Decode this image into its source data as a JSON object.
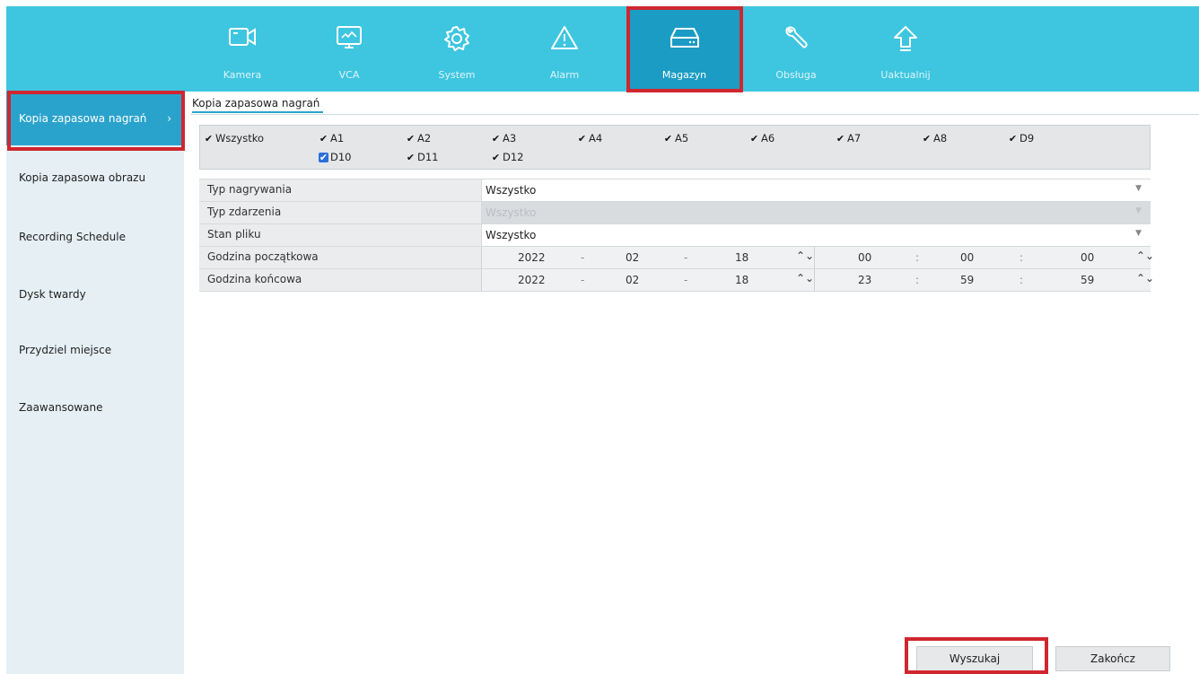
{
  "nav": [
    {
      "id": "kamera",
      "label": "Kamera",
      "icon": "camera-icon"
    },
    {
      "id": "vca",
      "label": "VCA",
      "icon": "monitor-icon"
    },
    {
      "id": "system",
      "label": "System",
      "icon": "gear-icon"
    },
    {
      "id": "alarm",
      "label": "Alarm",
      "icon": "warning-icon"
    },
    {
      "id": "magazyn",
      "label": "Magazyn",
      "icon": "hard-drive-icon",
      "active": true
    },
    {
      "id": "obsluga",
      "label": "Obsługa",
      "icon": "wrench-icon"
    },
    {
      "id": "uaktualnij",
      "label": "Uaktualnij",
      "icon": "upload-arrow-icon"
    }
  ],
  "sidebar": {
    "items": [
      {
        "label": "Kopia zapasowa nagrań",
        "active": true
      },
      {
        "label": "Kopia zapasowa obrazu"
      },
      {
        "label": "Recording Schedule"
      },
      {
        "label": "Dysk twardy"
      },
      {
        "label": "Przydziel miejsce"
      },
      {
        "label": "Zaawansowane"
      }
    ],
    "chevron": "›"
  },
  "tab": {
    "label": "Kopia zapasowa nagrań"
  },
  "channels": {
    "all_label": "Wszystko",
    "items": [
      {
        "label": "A1",
        "checked": true
      },
      {
        "label": "A2",
        "checked": true
      },
      {
        "label": "A3",
        "checked": true
      },
      {
        "label": "A4",
        "checked": true
      },
      {
        "label": "A5",
        "checked": true
      },
      {
        "label": "A6",
        "checked": true
      },
      {
        "label": "A7",
        "checked": true
      },
      {
        "label": "A8",
        "checked": true
      },
      {
        "label": "D9",
        "checked": true
      },
      {
        "label": "D10",
        "checked": true,
        "style": "blue"
      },
      {
        "label": "D11",
        "checked": true
      },
      {
        "label": "D12",
        "checked": true
      }
    ],
    "check_mark": "✔"
  },
  "form": {
    "record_type": {
      "label": "Typ nagrywania",
      "value": "Wszystko"
    },
    "event_type": {
      "label": "Typ zdarzenia",
      "value": "Wszystko",
      "disabled": true
    },
    "file_state": {
      "label": "Stan pliku",
      "value": "Wszystko"
    },
    "start": {
      "label": "Godzina początkowa",
      "year": "2022",
      "month": "02",
      "day": "18",
      "hour": "00",
      "minute": "00",
      "second": "00"
    },
    "end": {
      "label": "Godzina końcowa",
      "year": "2022",
      "month": "02",
      "day": "18",
      "hour": "23",
      "minute": "59",
      "second": "59"
    },
    "date_sep": "-",
    "time_sep": ":",
    "dropdown_arrow": "▼",
    "spin_glyph": "⌃⌄"
  },
  "buttons": {
    "search": "Wyszukaj",
    "close": "Zakończ"
  },
  "colors": {
    "topbar": "#3ec6e0",
    "active_nav": "#1b9cc4",
    "sidebar_active": "#2aa3cc",
    "highlight": "#d0262f"
  }
}
